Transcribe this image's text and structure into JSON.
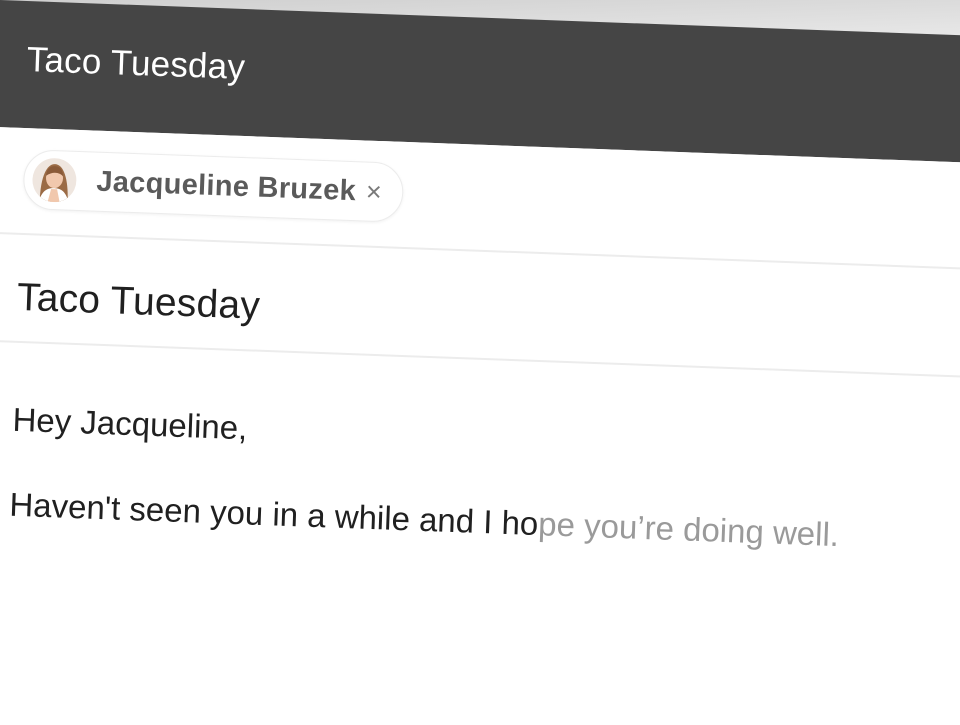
{
  "app_bar": {
    "title": "Taco Tuesday"
  },
  "recipient_chip": {
    "name": "Jacqueline Bruzek",
    "remove_glyph": "×",
    "avatar_icon": "person-avatar"
  },
  "subject": {
    "value": "Taco Tuesday"
  },
  "body": {
    "greeting": "Hey Jacqueline,",
    "typed_text": "Haven't seen you in a while and I ho",
    "suggestion_text": "pe you’re doing well."
  },
  "colors": {
    "app_bar_background": "#454545",
    "app_bar_text": "#ffffff",
    "typed_text": "#202020",
    "suggestion_text": "#9a9a9a"
  }
}
